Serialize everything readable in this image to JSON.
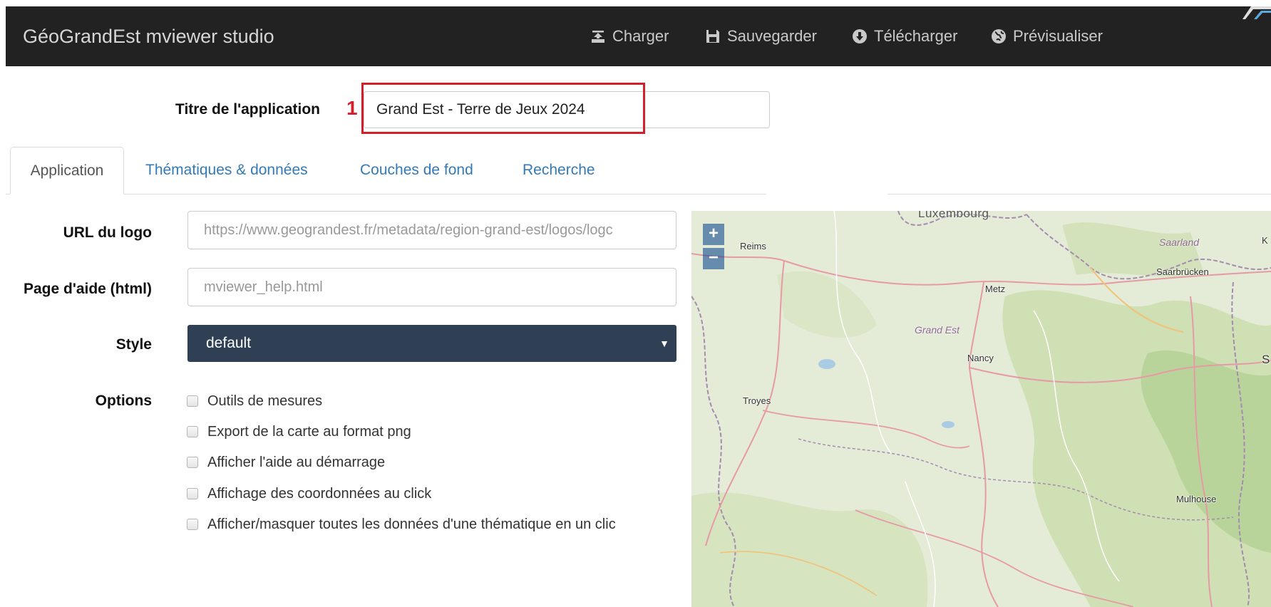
{
  "navbar": {
    "brand": "GéoGrandEst mviewer studio",
    "items": [
      {
        "label": "Charger",
        "icon": "upload-tray-icon"
      },
      {
        "label": "Sauvegarder",
        "icon": "floppy-disk-icon"
      },
      {
        "label": "Télécharger",
        "icon": "download-circle-icon"
      },
      {
        "label": "Prévisualiser",
        "icon": "globe-icon"
      }
    ]
  },
  "title_field": {
    "label": "Titre de l'application",
    "marker": "1",
    "value": "Grand Est - Terre de Jeux 2024",
    "highlight_color": "#d21f2b"
  },
  "tabs": [
    {
      "label": "Application",
      "active": true
    },
    {
      "label": "Thématiques & données",
      "active": false
    },
    {
      "label": "Couches de fond",
      "active": false
    },
    {
      "label": "Recherche",
      "active": false
    }
  ],
  "form": {
    "logo": {
      "label": "URL du logo",
      "placeholder": "https://www.geograndest.fr/metadata/region-grand-est/logos/logc"
    },
    "help": {
      "label": "Page d'aide (html)",
      "placeholder": "mviewer_help.html"
    },
    "style": {
      "label": "Style",
      "value": "default",
      "color": "#2f4054"
    },
    "options": {
      "label": "Options",
      "items": [
        {
          "label": "Outils de mesures",
          "checked": false
        },
        {
          "label": "Export de la carte au format png",
          "checked": false
        },
        {
          "label": "Afficher l'aide au démarrage",
          "checked": false
        },
        {
          "label": "Affichage des coordonnées au click",
          "checked": false
        },
        {
          "label": "Afficher/masquer toutes les données d'une thématique en un clic",
          "checked": false
        }
      ]
    }
  },
  "map": {
    "zoom_in": "+",
    "zoom_out": "−",
    "countries": [
      "Luxembourg"
    ],
    "regions": [
      "Saarland",
      "Grand Est"
    ],
    "cities": [
      "Reims",
      "Saarbrücken",
      "Metz",
      "Nancy",
      "Troyes",
      "Mulhouse",
      "S",
      "K"
    ]
  },
  "colors": {
    "navbar_bg": "#222222",
    "link": "#337ab7",
    "map_bg": "#e4ebd7"
  }
}
